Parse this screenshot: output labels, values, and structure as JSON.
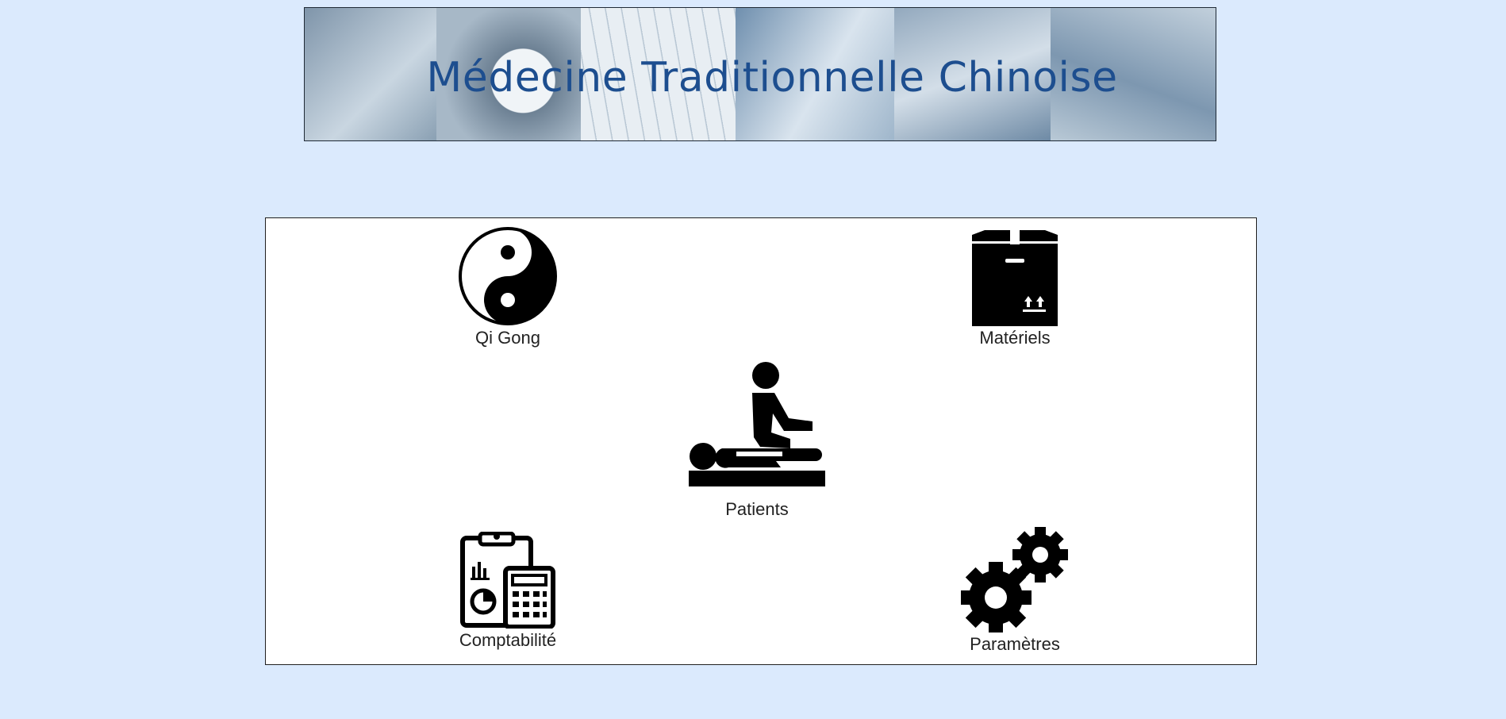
{
  "header": {
    "title": "Médecine Traditionnelle Chinoise"
  },
  "menu": {
    "qigong": {
      "label": "Qi Gong",
      "icon": "yin-yang-icon"
    },
    "materiels": {
      "label": "Matériels",
      "icon": "box-icon"
    },
    "patients": {
      "label": "Patients",
      "icon": "massage-icon"
    },
    "comptabilite": {
      "label": "Comptabilité",
      "icon": "accounting-icon"
    },
    "parametres": {
      "label": "Paramètres",
      "icon": "gears-icon"
    }
  },
  "colors": {
    "background": "#dbeafd",
    "title": "#1d4e8f",
    "icon": "#000000"
  }
}
